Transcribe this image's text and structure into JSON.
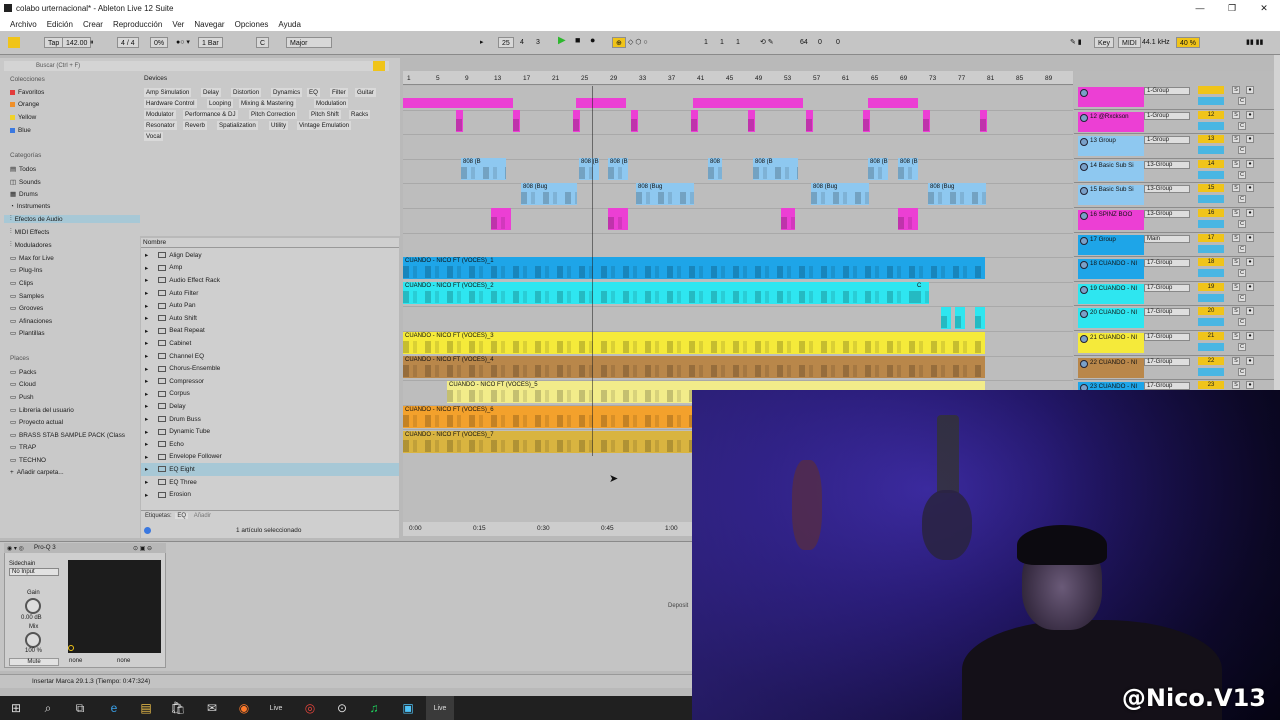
{
  "window": {
    "title": "colabo urternacional* - Ableton Live 12 Suite",
    "controls": [
      "—",
      "❐",
      "✕"
    ]
  },
  "menu": [
    "Archivo",
    "Edición",
    "Crear",
    "Reproducción",
    "Ver",
    "Navegar",
    "Opciones",
    "Ayuda"
  ],
  "control_bar": {
    "tap": "Tap",
    "tempo": "142.00",
    "time_sig": "4 / 4",
    "swing": "0%",
    "quant": "1 Bar",
    "key": "C",
    "scale": "Major",
    "pos1": "25",
    "pos2": "4",
    "pos3": "3",
    "loop1": "1",
    "loop2": "1",
    "loop3": "1",
    "len": "64",
    "len2": "0",
    "len3": "0",
    "key_label": "Key",
    "midi_label": "MIDI",
    "sample_rate": "44.1 kHz",
    "cpu": "40 %"
  },
  "browser": {
    "search_placeholder": "Buscar (Ctrl + F)",
    "collections_header": "Colecciones",
    "collections": [
      {
        "label": "Favoritos",
        "color": "#e23b3b"
      },
      {
        "label": "Orange",
        "color": "#f0902a"
      },
      {
        "label": "Yellow",
        "color": "#f0d22a"
      },
      {
        "label": "Blue",
        "color": "#3a78e0"
      }
    ],
    "categories_header": "Categorías",
    "categories": [
      "Todos",
      "Sounds",
      "Drums",
      "Instruments",
      "Efectos de Audio",
      "MIDI Effects",
      "Moduladores",
      "Max for Live",
      "Plug-Ins",
      "Clips",
      "Samples",
      "Grooves",
      "Afinaciones",
      "Plantillas"
    ],
    "places_header": "Places",
    "places": [
      "Packs",
      "Cloud",
      "Push",
      "Librería del usuario",
      "Proyecto actual",
      "BRASS STAB SAMPLE PACK (Class",
      "TRAP",
      "TECHNO",
      "Añadir carpeta..."
    ],
    "devices_label": "Devices",
    "device_chips": [
      [
        "Amp Simulation",
        "Delay",
        "Distortion",
        "Dynamics",
        "EQ",
        "Filter",
        "Guitar"
      ],
      [
        "Hardware Control",
        "Looping",
        "Mixing & Mastering",
        "Modulation"
      ],
      [
        "Modulator",
        "Performance & DJ",
        "Pitch Correction",
        "Pitch Shift",
        "Racks"
      ],
      [
        "Resonator",
        "Reverb",
        "Spatialization",
        "Utility",
        "Vintage Emulation"
      ],
      [
        "Vocal"
      ]
    ],
    "list_header": "Nombre",
    "list": [
      "Align Delay",
      "Amp",
      "Audio Effect Rack",
      "Auto Filter",
      "Auto Pan",
      "Auto Shift",
      "Beat Repeat",
      "Cabinet",
      "Channel EQ",
      "Chorus-Ensemble",
      "Compressor",
      "Corpus",
      "Delay",
      "Drum Buss",
      "Dynamic Tube",
      "Echo",
      "Envelope Follower",
      "EQ Eight",
      "EQ Three",
      "Erosion"
    ],
    "tags_label": "Etiquetas:",
    "tags_value": "EQ",
    "tags_add": "Añadir",
    "selection_status": "1 artículo seleccionado"
  },
  "arrangement": {
    "bar_labels": [
      "1",
      "5",
      "9",
      "13",
      "17",
      "21",
      "25",
      "29",
      "33",
      "37",
      "41",
      "45",
      "49",
      "53",
      "57",
      "61",
      "65",
      "69",
      "73",
      "77",
      "81",
      "85",
      "89"
    ],
    "time_labels": [
      "0:00",
      "0:15",
      "0:30",
      "0:45",
      "1:00"
    ],
    "midi_clip_label": "808 (Bug",
    "midi_clip_short": "808 (B",
    "clip_c": "C",
    "voice_clips": [
      "CUANDO - NICO FT (VOCES)_1",
      "CUANDO - NICO FT (VOCES)_2",
      "CUANDO - NICO FT (VOCES)_3",
      "CUANDO - NICO FT (VOCES)_4",
      "CUANDO - NICO FT (VOCES)_5",
      "CUANDO - NICO FT (VOCES)_6",
      "CUANDO - NICO FT (VOCES)_7"
    ],
    "colors": {
      "magenta": "#ec3fd4",
      "lightblue": "#8ec8f0",
      "blue": "#1ea5e8",
      "cyan": "#2ee6f0",
      "yellow": "#f5ea3a",
      "brown": "#b9874a",
      "paleyellow": "#f2ec8a",
      "orange": "#f3a12c",
      "gold": "#d9b440"
    }
  },
  "mixer": {
    "tracks": [
      {
        "name": "",
        "group": "1-Group",
        "num": "",
        "color": "#ec3fd4"
      },
      {
        "name": "12 @Rxckson",
        "group": "1-Group",
        "num": "12",
        "color": "#ec3fd4"
      },
      {
        "name": "13 Group",
        "group": "1-Group",
        "num": "13",
        "color": "#8ec8f0"
      },
      {
        "name": "14 Basic Sub Si",
        "group": "13-Group",
        "num": "14",
        "color": "#8ec8f0"
      },
      {
        "name": "15 Basic Sub Si",
        "group": "13-Group",
        "num": "15",
        "color": "#8ec8f0"
      },
      {
        "name": "16 SPINZ BOO",
        "group": "13-Group",
        "num": "16",
        "color": "#ec3fd4"
      },
      {
        "name": "17 Group",
        "group": "Main",
        "num": "17",
        "color": "#1ea5e8"
      },
      {
        "name": "18 CUANDO - NI",
        "group": "17-Group",
        "num": "18",
        "color": "#1ea5e8"
      },
      {
        "name": "19 CUANDO - NI",
        "group": "17-Group",
        "num": "19",
        "color": "#2ee6f0"
      },
      {
        "name": "20 CUANDO - NI",
        "group": "17-Group",
        "num": "20",
        "color": "#2ee6f0"
      },
      {
        "name": "21 CUANDO - NI",
        "group": "17-Group",
        "num": "21",
        "color": "#f5ea3a"
      },
      {
        "name": "22 CUANDO - NI",
        "group": "17-Group",
        "num": "22",
        "color": "#b9874a"
      },
      {
        "name": "23 CUANDO - NI",
        "group": "17-Group",
        "num": "23",
        "color": "#1ea5e8"
      }
    ],
    "s_label": "S",
    "c_label": "C"
  },
  "device": {
    "name": "Pro-Q 3",
    "sidechain": "Sidechain",
    "no_input": "No Input",
    "gain": "Gain",
    "gain_value": "0.00 dB",
    "mix": "Mix",
    "mix_value": "100 %",
    "mute": "Mute",
    "none1": "none",
    "none2": "none",
    "drop_hint": "Deposit"
  },
  "status_text": "Insertar Marca 29.1.3 (Tiempo: 0:47:324)",
  "taskbar": [
    "⊞",
    "⌕",
    "⧉",
    "e",
    "▤",
    "🛍",
    "✉",
    "◉",
    "Live",
    "◎",
    "⊙",
    "♫",
    "▣",
    "Live"
  ],
  "watermark": "@Nico.V13"
}
